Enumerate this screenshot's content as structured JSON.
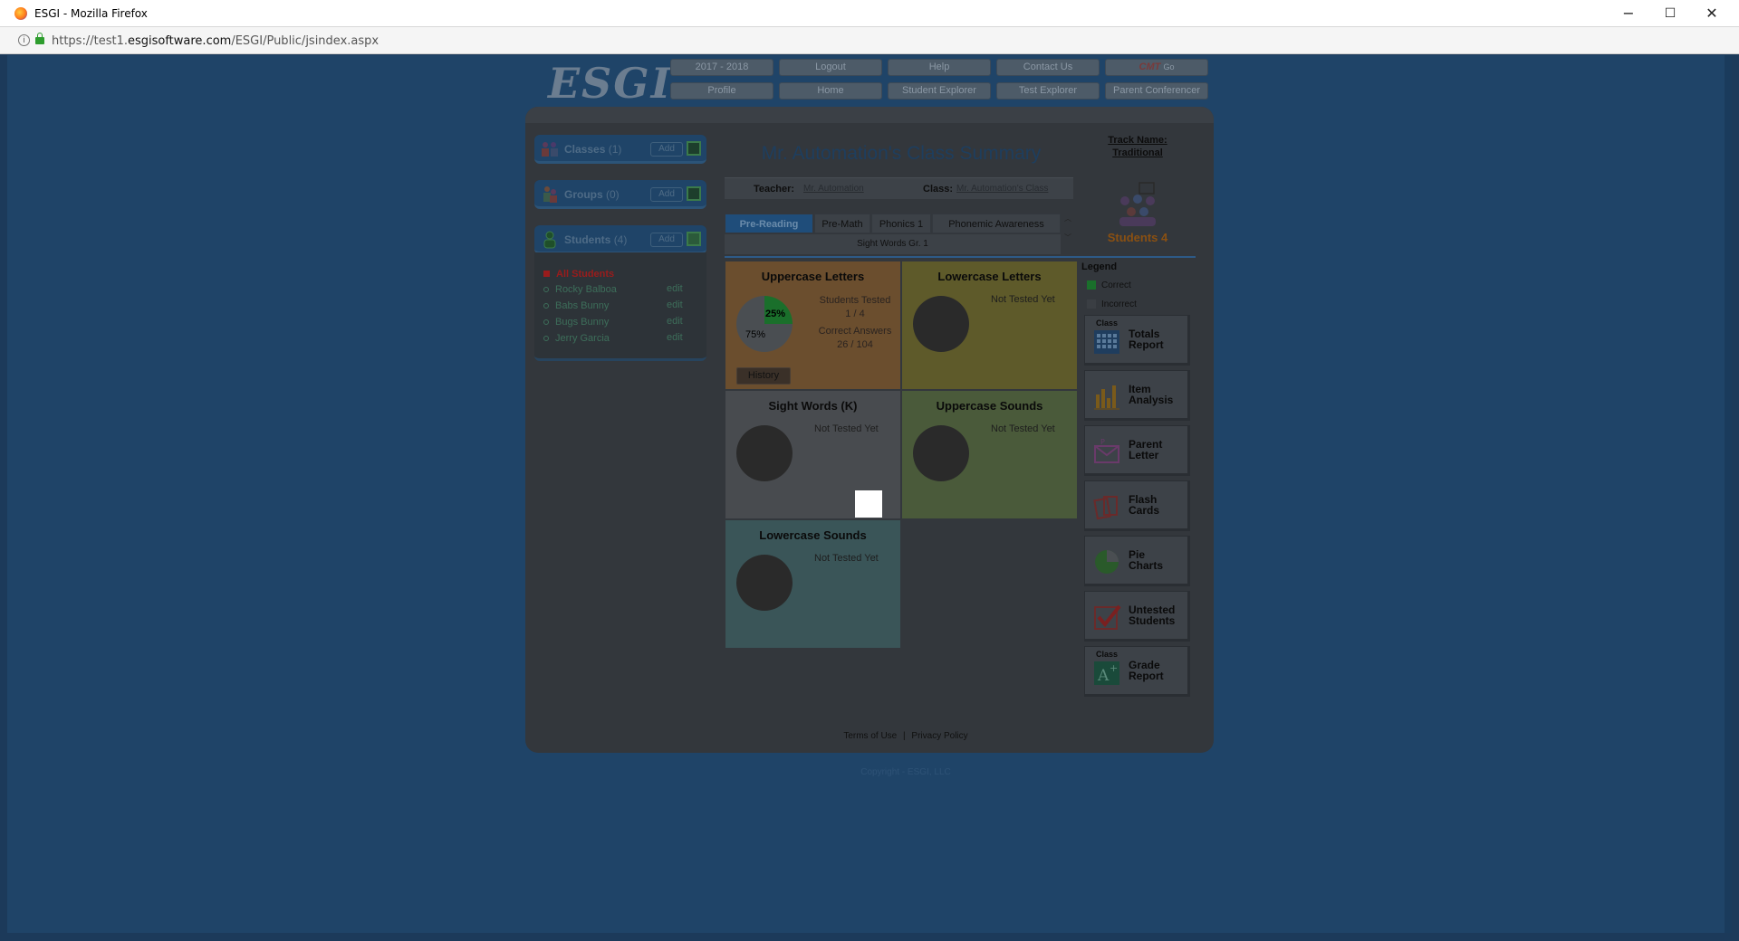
{
  "window": {
    "title": "ESGI - Mozilla Firefox",
    "minimize": "−",
    "maximize": "☐",
    "close": "✕"
  },
  "address_bar": {
    "url_prefix": "https://test1.",
    "url_domain": "esgisoftware.com",
    "url_path": "/ESGI/Public/jsindex.aspx"
  },
  "header": {
    "logo": "ESGI",
    "nav_row1": [
      "2017 - 2018",
      "Logout",
      "Help",
      "Contact Us"
    ],
    "cmt": "CMT",
    "cmt_go": "Go",
    "nav_row2": [
      "Profile",
      "Home",
      "Student Explorer",
      "Test Explorer",
      "Parent Conferencer"
    ]
  },
  "sidebar": {
    "classes": {
      "label": "Classes",
      "count": "(1)",
      "add": "Add"
    },
    "groups": {
      "label": "Groups",
      "count": "(0)",
      "add": "Add"
    },
    "students": {
      "label": "Students",
      "count": "(4)",
      "add": "Add"
    },
    "all_students": "All Students",
    "edit_label": "edit",
    "student_list": [
      "Rocky Balboa",
      "Babs Bunny",
      "Bugs Bunny",
      "Jerry Garcia"
    ]
  },
  "summary": {
    "title": "Mr. Automation's Class Summary",
    "track_label": "Track Name:",
    "track_value": "Traditional",
    "teacher_label": "Teacher:",
    "teacher_value": "Mr. Automation",
    "class_label": "Class:",
    "class_value": "Mr. Automation's Class",
    "students_count": "Students 4"
  },
  "tabs": {
    "row1": [
      "Pre-Reading",
      "Pre-Math",
      "Phonics 1",
      "Phonemic Awareness"
    ],
    "row2": "Sight Words Gr. 1",
    "scroll_up": "︿",
    "scroll_down": "﹀"
  },
  "tiles": [
    {
      "name": "Uppercase Letters",
      "color": "#6b4e2e",
      "tested_label": "Students Tested",
      "tested_value": "1 / 4",
      "correct_label": "Correct Answers",
      "correct_value": "26 / 104",
      "pct_correct": "25%",
      "pct_incorrect": "75%",
      "history": "History"
    },
    {
      "name": "Lowercase Letters",
      "color": "#5e5a2a",
      "status": "Not Tested Yet"
    },
    {
      "name": "Sight Words (K)",
      "color": "#484b4f",
      "status": "Not Tested Yet"
    },
    {
      "name": "Uppercase Sounds",
      "color": "#4a5a3a",
      "status": "Not Tested Yet"
    },
    {
      "name": "Lowercase Sounds",
      "color": "#3a5558",
      "status": "Not Tested Yet"
    }
  ],
  "legend": {
    "title": "Legend",
    "correct": "Correct",
    "incorrect": "Incorrect",
    "correct_color": "#1a6f2b",
    "incorrect_color": "#3a3e43"
  },
  "reports": [
    {
      "prefix": "Class",
      "line1": "Totals",
      "line2": "Report",
      "icon": "grid-icon"
    },
    {
      "prefix": "",
      "line1": "Item",
      "line2": "Analysis",
      "icon": "bar-chart-icon"
    },
    {
      "prefix": "",
      "line1": "Parent",
      "line2": "Letter",
      "icon": "envelope-icon"
    },
    {
      "prefix": "",
      "line1": "Flash",
      "line2": "Cards",
      "icon": "cards-icon"
    },
    {
      "prefix": "",
      "line1": "Pie",
      "line2": "Charts",
      "icon": "pie-icon"
    },
    {
      "prefix": "",
      "line1": "Untested",
      "line2": "Students",
      "icon": "checkmark-icon"
    },
    {
      "prefix": "Class",
      "line1": "Grade",
      "line2": "Report",
      "icon": "grade-icon"
    }
  ],
  "footer": {
    "terms": "Terms of Use",
    "separator": "|",
    "privacy": "Privacy Policy",
    "copyright": "Copyright - ESGI, LLC"
  }
}
